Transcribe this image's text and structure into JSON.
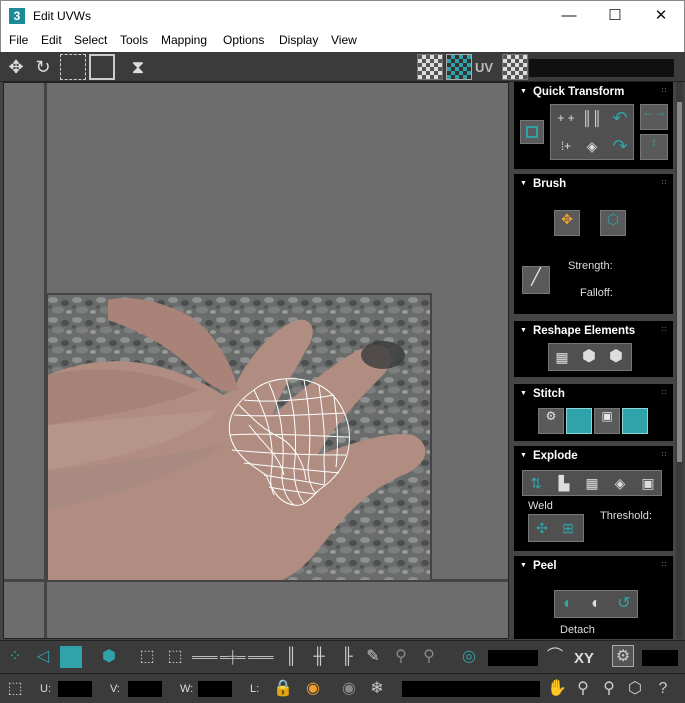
{
  "window": {
    "app_icon": "3",
    "title": "Edit UVWs",
    "minimize": "—",
    "maximize": "☐",
    "close": "✕"
  },
  "menu": [
    "File",
    "Edit",
    "Select",
    "Tools",
    "Mapping",
    "Options",
    "Display",
    "View"
  ],
  "toolbar": {
    "uv_label": "UV"
  },
  "panels": {
    "quick_transform": "Quick Transform",
    "brush": "Brush",
    "brush_strength": "Strength:",
    "brush_falloff": "Falloff:",
    "reshape": "Reshape Elements",
    "stitch": "Stitch",
    "explode": "Explode",
    "weld": "Weld",
    "threshold": "Threshold:",
    "peel": "Peel",
    "detach": "Detach"
  },
  "bottom": {
    "xy_label": "XY",
    "u_label": "U:",
    "v_label": "V:",
    "w_label": "W:",
    "l_label": "L:"
  },
  "colors": {
    "accent_teal": "#2fa3a9",
    "panel_bg": "#000000",
    "ui_bg": "#3b3b3b"
  }
}
